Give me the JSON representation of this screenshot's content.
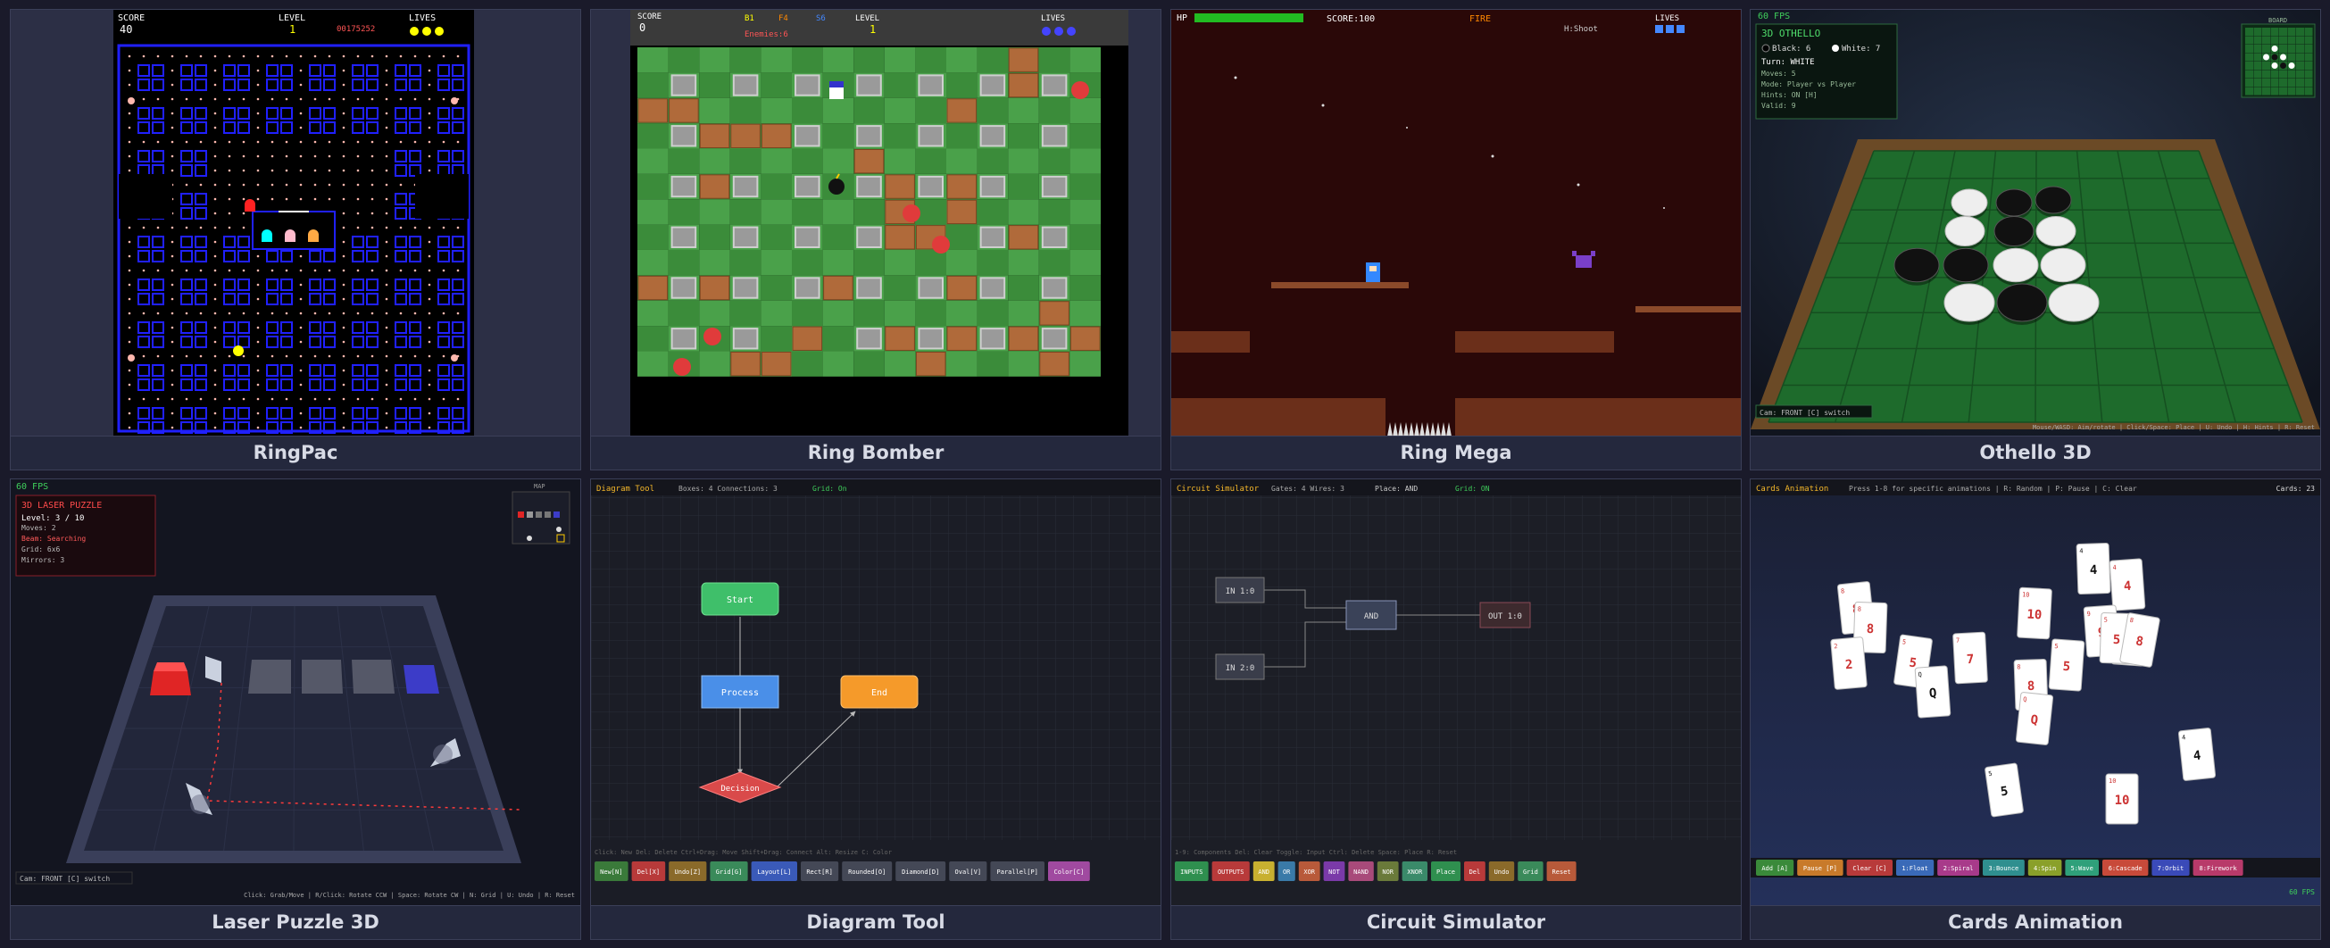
{
  "tiles": [
    {
      "title": "RingPac"
    },
    {
      "title": "Ring Bomber"
    },
    {
      "title": "Ring Mega"
    },
    {
      "title": "Othello 3D"
    },
    {
      "title": "Laser Puzzle 3D"
    },
    {
      "title": "Diagram Tool"
    },
    {
      "title": "Circuit Simulator"
    },
    {
      "title": "Cards Animation"
    }
  ],
  "ringpac": {
    "score_label": "SCORE",
    "score": "40",
    "level_label": "LEVEL",
    "level": "1",
    "mid_text": "00175252",
    "lives_label": "LIVES"
  },
  "bomber": {
    "score_label": "SCORE",
    "score": "0",
    "stat1": "B1",
    "stat2": "F4",
    "stat3": "S6",
    "sub": "Enemies:6",
    "level_label": "LEVEL",
    "level": "1",
    "lives_label": "LIVES"
  },
  "mega": {
    "hp_label": "HP",
    "score": "SCORE:100",
    "weapon": "FIRE",
    "shoot": "H:Shoot",
    "lives_label": "LIVES"
  },
  "othello": {
    "fps": "60 FPS",
    "title": "3D OTHELLO",
    "black": "Black: 6",
    "white": "White: 7",
    "turn": "Turn: WHITE",
    "moves": "Moves: 5",
    "mode": "Mode: Player vs Player",
    "hints": "Hints: ON [H]",
    "valid": "Valid: 9",
    "minimap": "BOARD",
    "cam": "Cam: FRONT  [C] switch",
    "help": "Mouse/WASD: Aim/rotate | Click/Space: Place | U: Undo | H: Hints | R: Reset"
  },
  "laser": {
    "fps": "60 FPS",
    "title": "3D LASER PUZZLE",
    "level": "Level: 3 / 10",
    "moves": "Moves: 2",
    "status": "Beam: Searching",
    "grid": "Grid: 6x6",
    "mirrors": "Mirrors: 3",
    "minimap": "MAP",
    "cam": "Cam: FRONT  [C] switch",
    "help": "Click: Grab/Move | R/Click: Rotate CCW | Space: Rotate CW | N: Grid | U: Undo | R: Reset"
  },
  "diagram": {
    "title": "Diagram Tool",
    "stats": "Boxes: 4  Connections: 3",
    "grid": "Grid: On",
    "nodes": {
      "start": "Start",
      "process": "Process",
      "end": "End",
      "decision": "Decision"
    },
    "help": "Click: New  Del: Delete  Ctrl+Drag: Move  Shift+Drag: Connect  Alt: Resize  C: Color",
    "toolbar": [
      "New[N]",
      "Del[X]",
      "Undo[Z]",
      "Grid[G]",
      "Layout[L]",
      "Rect[R]",
      "Rounded[O]",
      "Diamond[D]",
      "Oval[V]",
      "Parallel[P]",
      "Color[C]"
    ]
  },
  "circuit": {
    "title": "Circuit Simulator",
    "stats": "Gates: 4  Wires: 3",
    "place": "Place: AND",
    "grid": "Grid: ON",
    "gates": {
      "in1": "IN 1:0",
      "in2": "IN 2:0",
      "and": "AND",
      "out": "OUT 1:0"
    },
    "help": "1-9: Components  Del: Clear  Toggle: Input  Ctrl: Delete  Space: Place  R: Reset",
    "toolbar": [
      "INPUTS",
      "OUTPUTS",
      "AND",
      "OR",
      "XOR",
      "NOT",
      "NAND",
      "NOR",
      "XNOR",
      "Place",
      "Del",
      "Undo",
      "Grid",
      "Reset"
    ]
  },
  "cards": {
    "title": "Cards Animation",
    "hint": "Press 1-8 for specific animations | R: Random | P: Pause | C: Clear",
    "count": "Cards: 23",
    "fps": "60 FPS",
    "toolbar": [
      "Add [A]",
      "Pause [P]",
      "Clear [C]",
      "1:Float",
      "2:Spiral",
      "3:Bounce",
      "4:Spin",
      "5:Wave",
      "6:Cascade",
      "7:Orbit",
      "8:Firework"
    ]
  },
  "colors": {
    "accent": "#7a86c4",
    "maze": "#2020ff",
    "grass": "#3b8c3a",
    "felt": "#1e6b2c",
    "bg_label": "#24283d"
  }
}
